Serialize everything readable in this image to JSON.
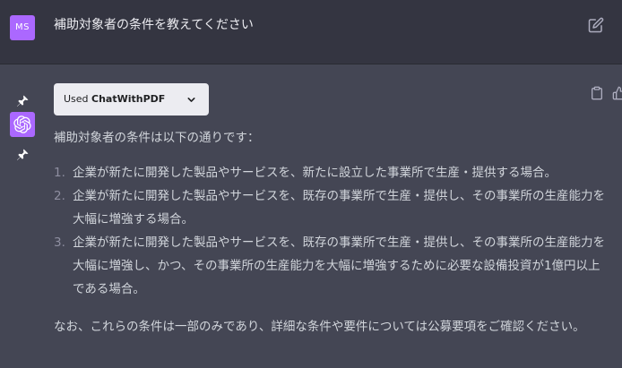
{
  "user": {
    "avatar_text": "MS",
    "avatar_color": "#ab68ff",
    "message": "補助対象者の条件を教えてください"
  },
  "assistant": {
    "avatar_color": "#ab68ff",
    "plugin": {
      "used_label": "Used",
      "name": "ChatWithPDF"
    },
    "intro": "補助対象者の条件は以下の通りです：",
    "items": [
      {
        "number": "1.",
        "lines": [
          "企業が新たに開発した製品やサービスを、新たに設立した事業所で生産・提供する場合。"
        ]
      },
      {
        "number": "2.",
        "lines": [
          "企業が新たに開発した製品やサービスを、既存の事業所で生産・提供し、その事業所の生産能力を",
          "大幅に増強する場合。"
        ]
      },
      {
        "number": "3.",
        "lines": [
          "企業が新たに開発した製品やサービスを、既存の事業所で生産・提供し、その事業所の生産能力を",
          "大幅に増強し、かつ、その事業所の生産能力を大幅に増強するために必要な設備投資が1億円以上",
          "である場合。"
        ]
      }
    ],
    "outro": "なお、これらの条件は一部のみであり、詳細な条件や要件については公募要項をご確認ください。"
  },
  "icons": {
    "edit": "edit-icon",
    "pin": "pin-icon",
    "openai": "openai-logo-icon",
    "chevron": "chevron-down-icon",
    "copy": "clipboard-icon",
    "thumb": "thumbs-up-icon"
  }
}
